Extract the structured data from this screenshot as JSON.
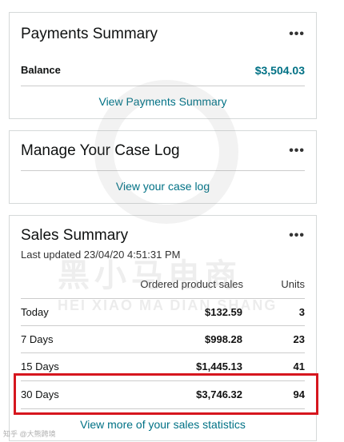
{
  "payments": {
    "title": "Payments Summary",
    "more": "•••",
    "balance_label": "Balance",
    "balance_value": "$3,504.03",
    "link": "View Payments Summary"
  },
  "caselog": {
    "title": "Manage Your Case Log",
    "more": "•••",
    "link": "View your case log"
  },
  "sales": {
    "title": "Sales Summary",
    "more": "•••",
    "updated": "Last updated 23/04/20 4:51:31 PM",
    "headers": {
      "ops": "Ordered product sales",
      "units": "Units"
    },
    "rows": [
      {
        "period": "Today",
        "amount": "$132.59",
        "units": "3"
      },
      {
        "period": "7 Days",
        "amount": "$998.28",
        "units": "23"
      },
      {
        "period": "15 Days",
        "amount": "$1,445.13",
        "units": "41"
      },
      {
        "period": "30 Days",
        "amount": "$3,746.32",
        "units": "94"
      }
    ],
    "link": "View more of your sales statistics"
  },
  "watermark": {
    "cn": "黑小马电商",
    "en": "HEI XIAO MA DIAN SHANG",
    "corner": "知乎 @大熊跨境"
  }
}
